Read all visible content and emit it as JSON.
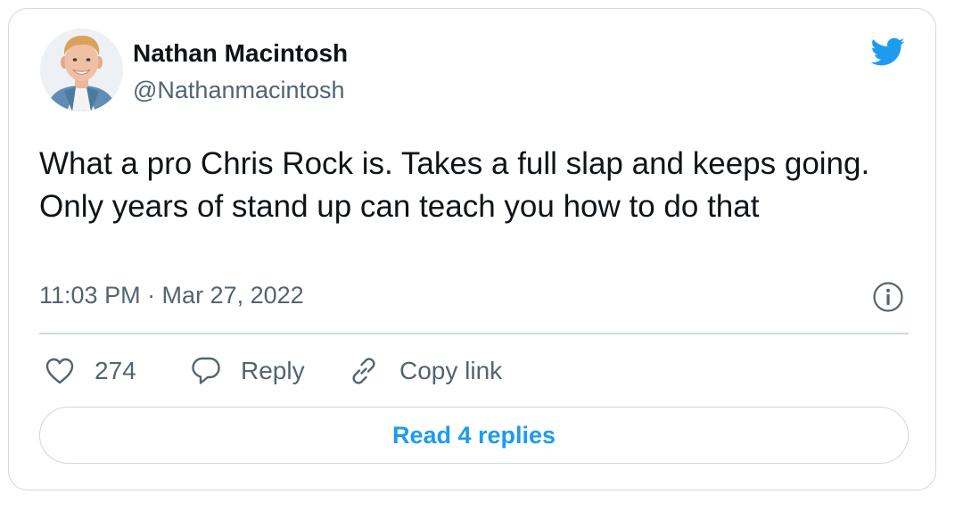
{
  "tweet": {
    "author": {
      "name": "Nathan Macintosh",
      "handle": "@Nathanmacintosh"
    },
    "text": "What a pro Chris Rock is. Takes a full slap and keeps going. Only years of stand up can teach you how to do that",
    "timestamp": "11:03 PM · Mar 27, 2022",
    "actions": {
      "like_count": "274",
      "reply_label": "Reply",
      "copy_link_label": "Copy link"
    },
    "read_replies_label": "Read 4 replies"
  },
  "colors": {
    "brand": "#1d9bf0",
    "text_primary": "#0f1419",
    "text_secondary": "#536471",
    "border": "#cfd9de"
  },
  "icons": [
    "twitter-bird-icon",
    "info-icon",
    "heart-icon",
    "reply-icon",
    "link-icon"
  ]
}
